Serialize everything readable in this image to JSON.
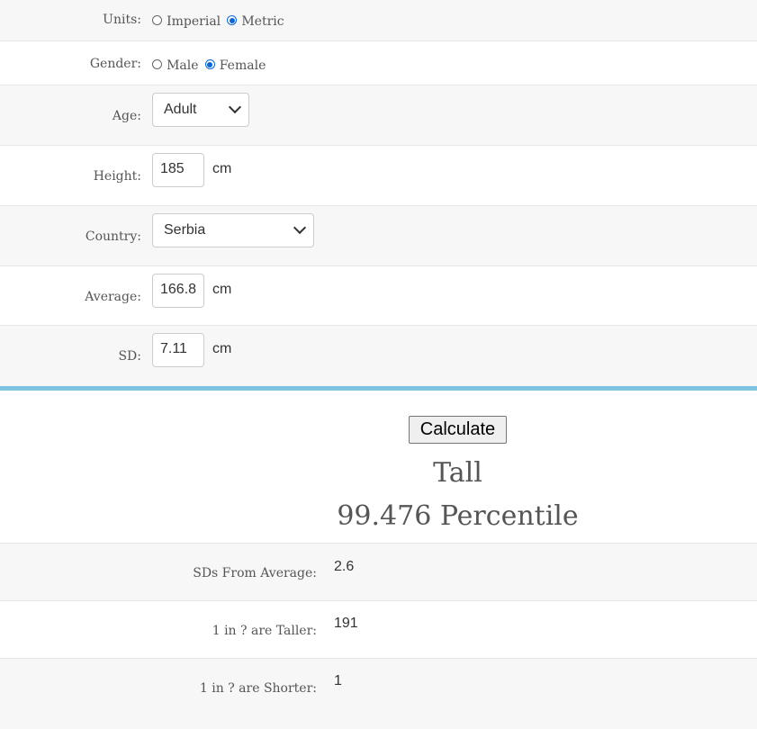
{
  "form": {
    "units": {
      "label": "Units:",
      "options": [
        "Imperial",
        "Metric"
      ],
      "selected": "Metric"
    },
    "gender": {
      "label": "Gender:",
      "options": [
        "Male",
        "Female"
      ],
      "selected": "Female"
    },
    "age": {
      "label": "Age:",
      "value": "Adult"
    },
    "height": {
      "label": "Height:",
      "value": "185",
      "unit": "cm"
    },
    "country": {
      "label": "Country:",
      "value": "Serbia"
    },
    "average": {
      "label": "Average:",
      "value": "166.8",
      "unit": "cm"
    },
    "sd": {
      "label": "SD:",
      "value": "7.11",
      "unit": "cm"
    }
  },
  "calculate_label": "Calculate",
  "result": {
    "category": "Tall",
    "percentile": "99.476 Percentile"
  },
  "stats": [
    {
      "label": "SDs From Average:",
      "value": "2.6"
    },
    {
      "label": "1 in ? are Taller:",
      "value": "191"
    },
    {
      "label": "1 in ? are Shorter:",
      "value": "1"
    }
  ],
  "colors": {
    "accent_bar": "#7ec4e0",
    "radio_selected": "#0a66d8"
  }
}
